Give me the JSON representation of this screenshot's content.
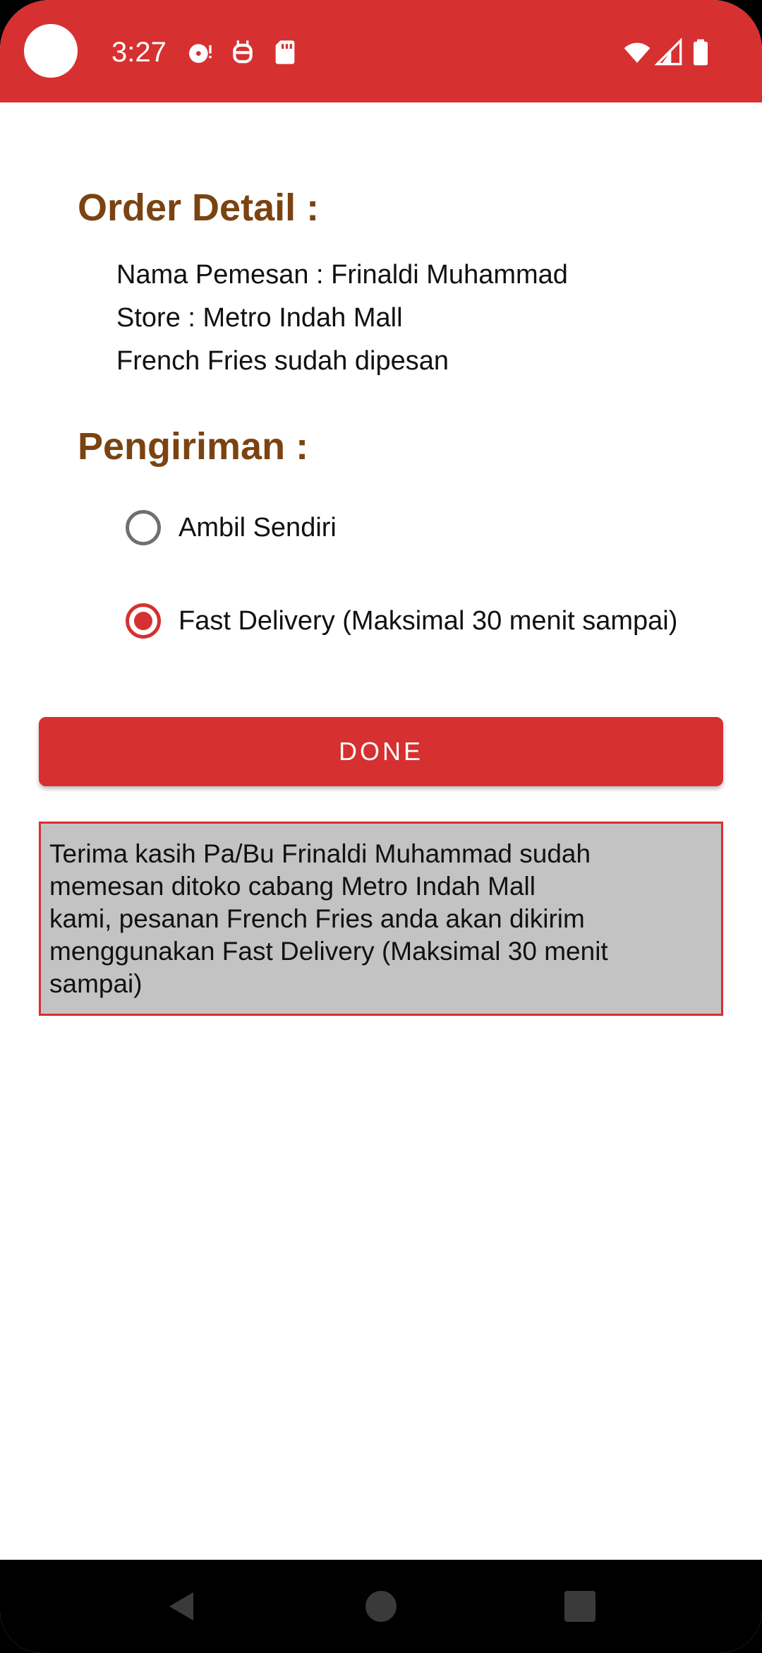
{
  "status_bar": {
    "time": "3:27",
    "left_icons": [
      "media-disc-icon",
      "robot-icon",
      "sd-card-icon"
    ],
    "right_icons": [
      "wifi-icon",
      "cellular-signal-icon",
      "battery-icon"
    ],
    "background_color": "#d63031"
  },
  "order_detail": {
    "title": "Order Detail :",
    "nama_pemesan": "Nama Pemesan : Frinaldi Muhammad",
    "store": "Store : Metro Indah Mall",
    "item": "French Fries sudah dipesan"
  },
  "pengiriman": {
    "title": "Pengiriman :",
    "options": [
      {
        "label": "Ambil Sendiri",
        "selected": false
      },
      {
        "label": "Fast Delivery (Maksimal 30 menit sampai)",
        "selected": true
      }
    ]
  },
  "done_button": {
    "label": "DONE"
  },
  "result_message": "Terima kasih Pa/Bu Frinaldi Muhammad sudah\nmemesan ditoko cabang Metro Indah Mall\nkami, pesanan French Fries anda akan dikirim\nmenggunakan Fast Delivery (Maksimal 30 menit\nsampai)",
  "colors": {
    "accent": "#d63031",
    "title_brown": "#7a4311",
    "result_box_bg": "#c3c3c3"
  },
  "nav_bar": {
    "buttons": [
      "back-icon",
      "home-icon",
      "recents-icon"
    ]
  }
}
